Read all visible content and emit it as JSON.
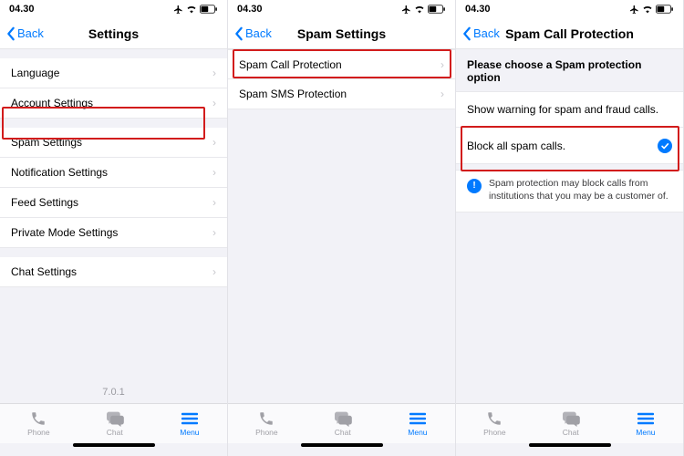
{
  "statusbar": {
    "time": "04.30"
  },
  "screens": {
    "settings": {
      "back": "Back",
      "title": "Settings",
      "rows": {
        "language": "Language",
        "account": "Account Settings",
        "spam": "Spam Settings",
        "notification": "Notification Settings",
        "feed": "Feed Settings",
        "private": "Private Mode Settings",
        "chat": "Chat Settings"
      },
      "version": "7.0.1"
    },
    "spam_settings": {
      "back": "Back",
      "title": "Spam Settings",
      "rows": {
        "call": "Spam Call Protection",
        "sms": "Spam SMS Protection"
      }
    },
    "spam_call": {
      "back": "Back",
      "title": "Spam Call Protection",
      "heading": "Please choose a Spam protection option",
      "rows": {
        "warn": "Show warning for spam and fraud calls.",
        "block": "Block all spam calls."
      },
      "info": "Spam protection may block calls from institutions that you may be a customer of."
    }
  },
  "tabbar": {
    "phone": "Phone",
    "chat": "Chat",
    "menu": "Menu"
  }
}
